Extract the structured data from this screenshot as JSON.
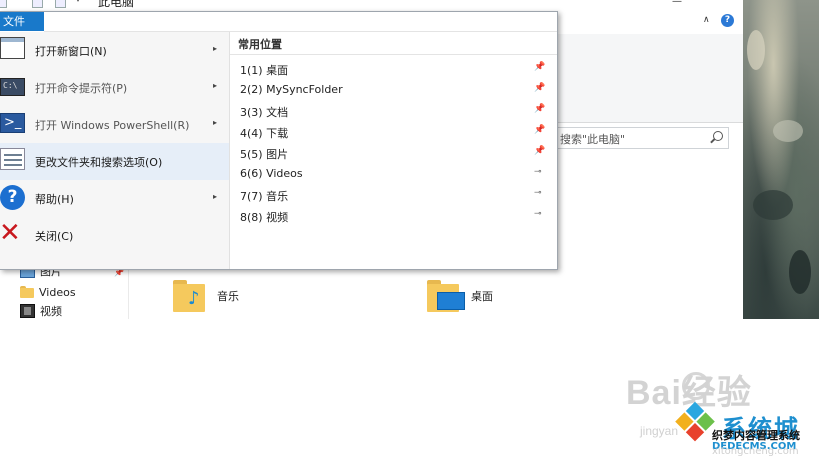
{
  "window": {
    "title": "此电脑",
    "help_glyph": "?",
    "expand_glyph": "∧"
  },
  "file_tab": {
    "label": "文件"
  },
  "file_menu": {
    "items": [
      {
        "label": "打开新窗口(N)",
        "has_submenu": true,
        "icon": "new-window-icon",
        "selected": false
      },
      {
        "label": "打开命令提示符(P)",
        "has_submenu": true,
        "icon": "command-prompt-icon",
        "selected": false
      },
      {
        "label": "打开 Windows PowerShell(R)",
        "has_submenu": true,
        "icon": "powershell-icon",
        "selected": false
      },
      {
        "label": "更改文件夹和搜索选项(O)",
        "has_submenu": false,
        "icon": "folder-options-icon",
        "selected": true
      },
      {
        "label": "帮助(H)",
        "has_submenu": true,
        "icon": "help-icon",
        "selected": false
      },
      {
        "label": "关闭(C)",
        "has_submenu": false,
        "icon": "close-icon",
        "selected": false
      }
    ],
    "submenu_arrow": "▸",
    "places_header": "常用位置",
    "places": [
      {
        "index": "1(1)",
        "name": "桌面",
        "pinned": true
      },
      {
        "index": "2(2)",
        "name": "MySyncFolder",
        "pinned": true
      },
      {
        "index": "3(3)",
        "name": "文档",
        "pinned": true
      },
      {
        "index": "4(4)",
        "name": "下载",
        "pinned": true
      },
      {
        "index": "5(5)",
        "name": "图片",
        "pinned": true
      },
      {
        "index": "6(6)",
        "name": "Videos",
        "pinned": false
      },
      {
        "index": "7(7)",
        "name": "音乐",
        "pinned": false
      },
      {
        "index": "8(8)",
        "name": "视频",
        "pinned": false
      }
    ],
    "pin_glyph": "📌",
    "unpin_glyph": "⊸"
  },
  "search": {
    "text": "搜索\"此电脑\""
  },
  "nav_pane": {
    "items": [
      {
        "label": "图片",
        "icon": "pictures-icon"
      },
      {
        "label": "Videos",
        "icon": "folder-icon"
      },
      {
        "label": "视频",
        "icon": "video-icon"
      }
    ]
  },
  "content": {
    "folders": [
      {
        "label": "音乐",
        "icon": "music-folder-icon"
      },
      {
        "label": "桌面",
        "icon": "desktop-folder-icon"
      }
    ]
  },
  "watermarks": {
    "baidu": "Bai经验",
    "jingyan": "jingyan",
    "xitong": "系统城",
    "zhimeng": "织梦内容管理系统",
    "dede": "DEDECMS.COM",
    "xitongcheng": "xitongcheng.com"
  },
  "colors": {
    "file_tab": "#1979ca",
    "selected_item": "#e6eef8",
    "close_red": "#c8181e",
    "help_blue": "#1c6fd0"
  }
}
